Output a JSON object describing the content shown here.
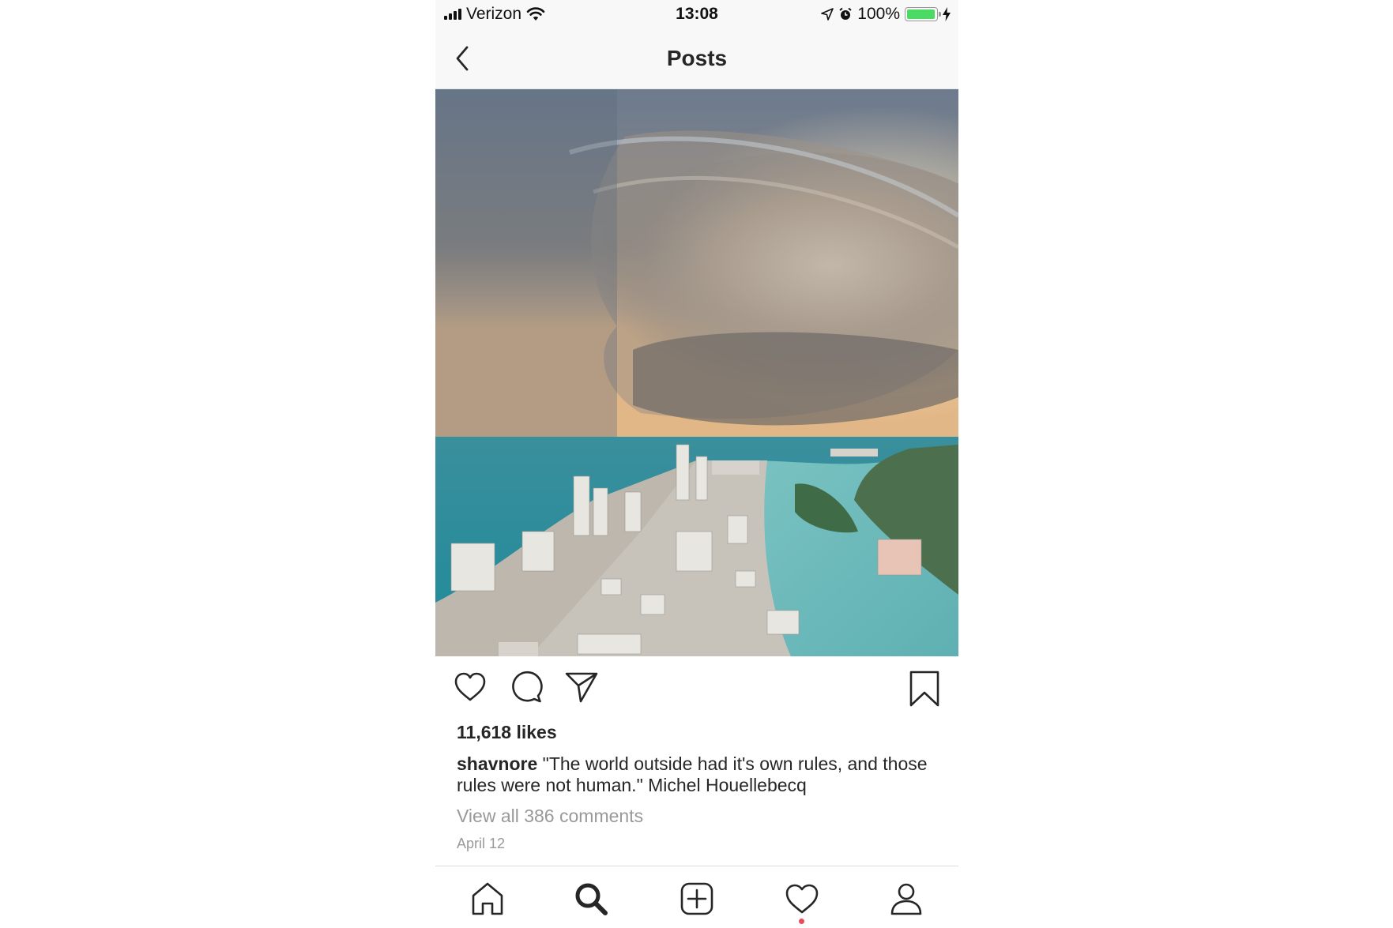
{
  "status_bar": {
    "carrier": "Verizon",
    "time": "13:08",
    "battery_percent": "100%",
    "battery_level": 1.0,
    "battery_color": "#4cd964",
    "icons": [
      "cellular-signal-icon",
      "wifi-icon",
      "location-arrow-icon",
      "alarm-icon",
      "battery-icon",
      "charging-bolt-icon"
    ]
  },
  "header": {
    "title": "Posts",
    "back_icon": "chevron-left-icon"
  },
  "post": {
    "image_description_icon": "photo",
    "likes": "11,618 likes",
    "username": "shavnore",
    "caption": "\"The world outside had it's own rules, and those rules were not human.\" Michel Houellebecq",
    "comments_link": "View all 386 comments",
    "date": "April 12",
    "actions": [
      "heart-icon",
      "comment-icon",
      "share-icon",
      "bookmark-icon"
    ]
  },
  "tab_bar": {
    "tabs": [
      "home-icon",
      "search-icon",
      "new-post-icon",
      "activity-heart-icon",
      "profile-icon"
    ],
    "active": "search-icon",
    "notification_color": "#ed4956"
  }
}
